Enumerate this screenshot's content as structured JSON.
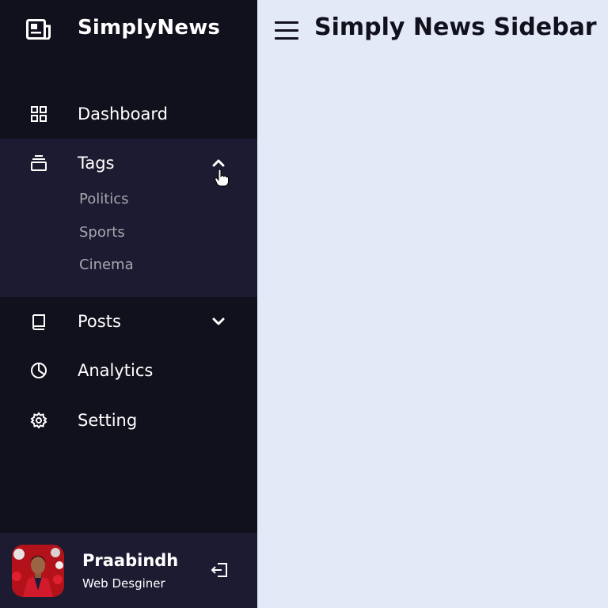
{
  "brand": {
    "name": "SimplyNews",
    "logo_icon": "newspaper-icon"
  },
  "header": {
    "title": "Simply News Sidebar",
    "menu_icon": "hamburger-menu-icon"
  },
  "nav": {
    "dashboard": {
      "label": "Dashboard",
      "icon": "grid-icon"
    },
    "tags": {
      "label": "Tags",
      "icon": "collection-icon",
      "expanded": true,
      "children": [
        "Politics",
        "Sports",
        "Cinema"
      ]
    },
    "posts": {
      "label": "Posts",
      "icon": "book-icon",
      "expanded": false
    },
    "analytics": {
      "label": "Analytics",
      "icon": "pie-chart-icon"
    },
    "setting": {
      "label": "Setting",
      "icon": "gear-icon"
    }
  },
  "profile": {
    "name": "Praabindh",
    "job": "Web Desginer"
  },
  "colors": {
    "sidebar_bg": "#11101d",
    "active_bg": "#1d1b31",
    "page_bg": "#e4e9f7",
    "sub_text": "#a6a7b0"
  }
}
